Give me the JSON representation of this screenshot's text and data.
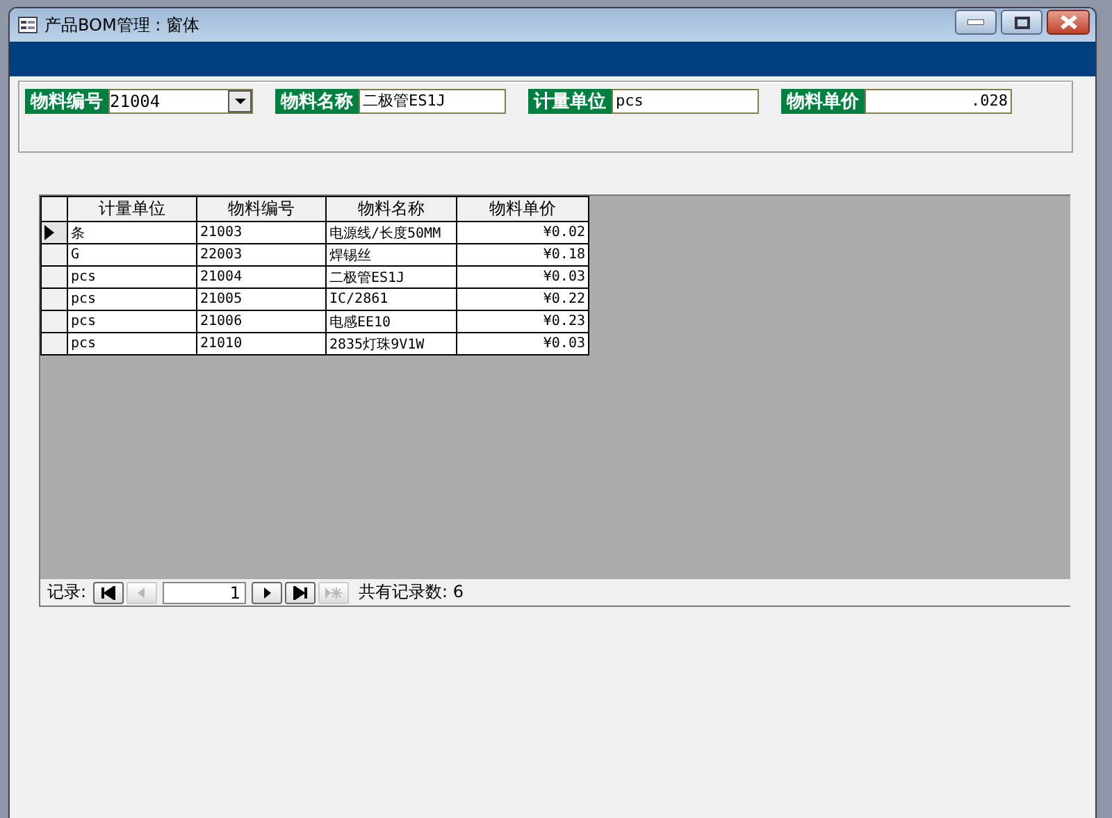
{
  "window": {
    "title": "产品BOM管理 : 窗体"
  },
  "header_fields": [
    {
      "label": "物料编号",
      "value": "21004",
      "kind": "combo"
    },
    {
      "label": "物料名称",
      "value": "二极管ES1J",
      "kind": "text"
    },
    {
      "label": "计量单位",
      "value": "pcs",
      "kind": "text"
    },
    {
      "label": "物料单价",
      "value": ".028",
      "kind": "number"
    }
  ],
  "table": {
    "columns": [
      "计量单位",
      "物料编号",
      "物料名称",
      "物料单价"
    ],
    "rows": [
      {
        "cells": [
          "条",
          "21003",
          "电源线/长度50MM",
          "¥0.02"
        ],
        "selected": true
      },
      {
        "cells": [
          "G",
          "22003",
          "焊锡丝",
          "¥0.18"
        ],
        "selected": false
      },
      {
        "cells": [
          "pcs",
          "21004",
          "二极管ES1J",
          "¥0.03"
        ],
        "selected": false
      },
      {
        "cells": [
          "pcs",
          "21005",
          "IC/2861",
          "¥0.22"
        ],
        "selected": false
      },
      {
        "cells": [
          "pcs",
          "21006",
          "电感EE10",
          "¥0.23"
        ],
        "selected": false
      },
      {
        "cells": [
          "pcs",
          "21010",
          "2835灯珠9V1W",
          "¥0.03"
        ],
        "selected": false
      }
    ]
  },
  "navigator": {
    "label": "记录:",
    "record": "1",
    "total": "共有记录数: 6",
    "buttons": [
      {
        "kind": "first",
        "disabled": false
      },
      {
        "kind": "prev",
        "disabled": true
      },
      {
        "kind": "next",
        "disabled": false
      },
      {
        "kind": "last",
        "disabled": false
      },
      {
        "kind": "new",
        "disabled": true
      }
    ]
  }
}
